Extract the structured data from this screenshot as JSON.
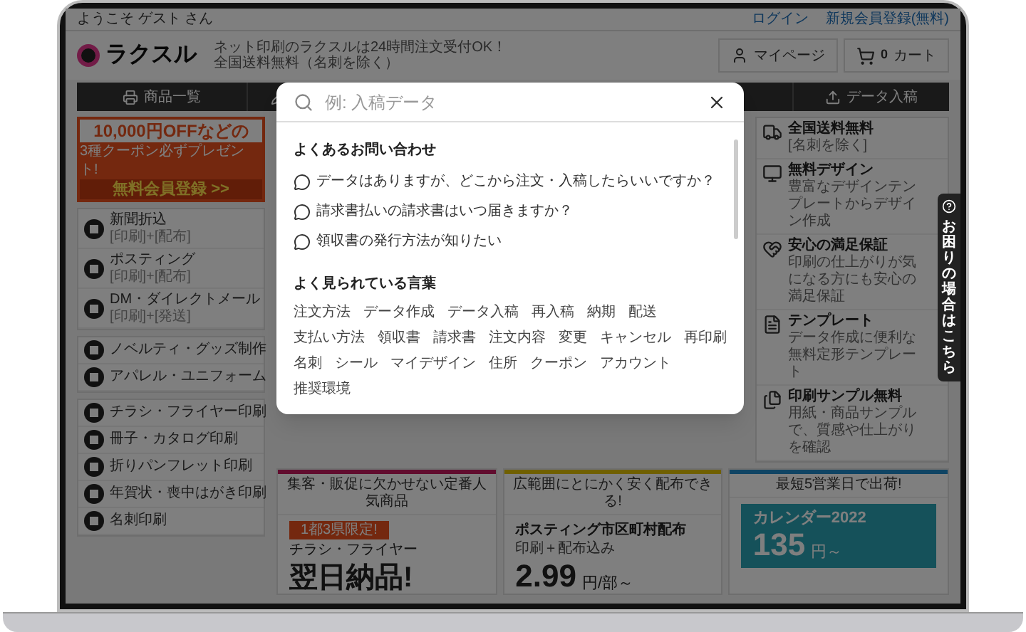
{
  "site": {
    "greeting": "ようこそ ゲスト さん",
    "top_links": [
      "ログイン",
      "新規会員登録(無料)"
    ],
    "logo": "ラクスル",
    "tagline": [
      "ネット印刷のラクスルは24時間注文受付OK！",
      "全国送料無料（名刺を除く）"
    ],
    "mypage": "マイページ",
    "cart_count": "0",
    "cart": "カート",
    "nav": [
      "商品一覧",
      "データ入稿"
    ],
    "promo": {
      "headline": "10,000円OFFなどの",
      "subline": "3種クーポン必ずプレゼント!",
      "cta": "無料会員登録 >>"
    },
    "category_groups": [
      [
        {
          "label": "新聞折込",
          "sub": "[印刷]+[配布]"
        },
        {
          "label": "ポスティング",
          "sub": "[印刷]+[配布]"
        },
        {
          "label": "DM・ダイレクトメール",
          "sub": "[印刷]+[発送]"
        }
      ],
      [
        {
          "label": "ノベルティ・グッズ制作"
        },
        {
          "label": "アパレル・ユニフォーム"
        }
      ],
      [
        {
          "label": "チラシ・フライヤー印刷"
        },
        {
          "label": "冊子・カタログ印刷"
        },
        {
          "label": "折りパンフレット印刷"
        },
        {
          "label": "年賀状・喪中はがき印刷"
        },
        {
          "label": "名刺印刷"
        }
      ]
    ],
    "features": [
      {
        "kind": "shipping",
        "title": "全国送料無料",
        "desc": "[名刺を除く]"
      },
      {
        "kind": "design",
        "title": "無料デザイン",
        "desc": "豊富なデザインテンプレートからデザイン作成"
      },
      {
        "kind": "guarantee",
        "title": "安心の満足保証",
        "desc": "印刷の仕上がりが気になる方にも安心の満足保証"
      },
      {
        "kind": "template",
        "title": "テンプレート",
        "desc": "データ作成に便利な無料定形テンプレート"
      },
      {
        "kind": "sample",
        "title": "印刷サンプル無料",
        "desc": "用紙・商品サンプルで、質感や仕上がりを確認"
      }
    ],
    "help_tab": "お困りの場合はこちら",
    "cards": [
      {
        "kind": "flyer",
        "color": "#610c2e",
        "caption": "集客・販促に欠かせない定番人気商品",
        "badge": "1都3県限定!",
        "product": "チラシ・フライヤー",
        "headline": "翌日納品!"
      },
      {
        "kind": "posting",
        "color": "#706000",
        "caption": "広範囲にとにかく安く配布できる!",
        "title": "ポスティング市区町村配布",
        "note": "印刷＋配布込み",
        "price": "2.99",
        "unit": "円/部～"
      },
      {
        "kind": "calendar",
        "color": "#0f4464",
        "caption": "最短5営業日で出荷!",
        "title": "カレンダー2022",
        "price": "135",
        "unit": "円～"
      }
    ]
  },
  "search_modal": {
    "placeholder": "例: 入稿データ",
    "faq_title": "よくあるお問い合わせ",
    "faqs": [
      "データはありますが、どこから注文・入稿したらいいですか？",
      "請求書払いの請求書はいつ届きますか？",
      "領収書の発行方法が知りたい"
    ],
    "keywords_title": "よく見られている言葉",
    "keywords": [
      "注文方法",
      "データ作成",
      "データ入稿",
      "再入稿",
      "納期",
      "配送",
      "支払い方法",
      "領収書",
      "請求書",
      "注文内容",
      "変更",
      "キャンセル",
      "再印刷",
      "名刺",
      "シール",
      "マイデザイン",
      "住所",
      "クーポン",
      "アカウント",
      "推奨環境"
    ]
  }
}
